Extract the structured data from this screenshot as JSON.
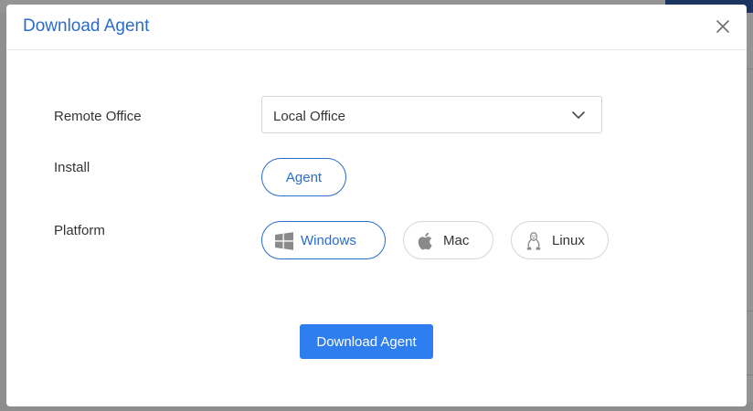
{
  "modal": {
    "title": "Download Agent"
  },
  "form": {
    "remote_office_label": "Remote Office",
    "remote_office_value": "Local Office",
    "install_label": "Install",
    "install_option": "Agent",
    "platform_label": "Platform",
    "platforms": [
      {
        "label": "Windows",
        "icon": "windows-icon",
        "selected": true
      },
      {
        "label": "Mac",
        "icon": "apple-icon",
        "selected": false
      },
      {
        "label": "Linux",
        "icon": "linux-icon",
        "selected": false
      }
    ]
  },
  "actions": {
    "download_label": "Download Agent"
  },
  "colors": {
    "accent": "#2a6cc8",
    "primary_button": "#2f7ef0"
  }
}
